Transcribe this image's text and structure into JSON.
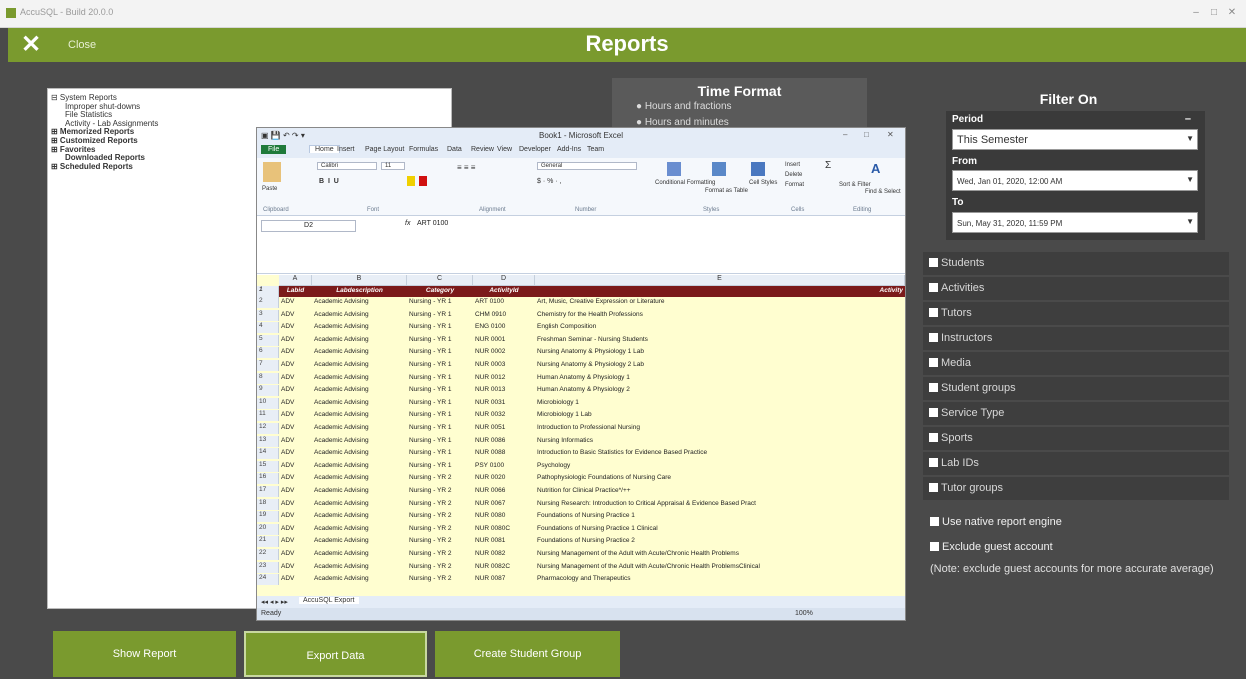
{
  "os_window": {
    "title": "AccuSQL - Build 20.0.0"
  },
  "header": {
    "close_label": "Close",
    "title": "Reports"
  },
  "tree": [
    {
      "label": "System Reports",
      "prefix": "⊟",
      "bold": false,
      "indent": 0
    },
    {
      "label": "Improper shut-downs",
      "prefix": "",
      "bold": false,
      "indent": 1
    },
    {
      "label": "File Statistics",
      "prefix": "",
      "bold": false,
      "indent": 1
    },
    {
      "label": "Activity - Lab Assignments",
      "prefix": "",
      "bold": false,
      "indent": 1
    },
    {
      "label": "Memorized Reports",
      "prefix": "⊞",
      "bold": true,
      "indent": 0
    },
    {
      "label": "Customized Reports",
      "prefix": "⊞",
      "bold": true,
      "indent": 0
    },
    {
      "label": "Favorites",
      "prefix": "⊞",
      "bold": true,
      "indent": 0
    },
    {
      "label": "Downloaded Reports",
      "prefix": "",
      "bold": true,
      "indent": 1
    },
    {
      "label": "Scheduled Reports",
      "prefix": "⊞",
      "bold": true,
      "indent": 0
    }
  ],
  "time_format": {
    "title": "Time Format",
    "options": [
      "Hours and fractions",
      "Hours and minutes"
    ]
  },
  "filter": {
    "title": "Filter On",
    "period_label": "Period",
    "period_value": "This Semester",
    "from_label": "From",
    "from_value": "Wed, Jan 01, 2020, 12:00 AM",
    "to_label": "To",
    "to_value": "Sun, May 31, 2020, 11:59 PM",
    "categories": [
      "Students",
      "Activities",
      "Tutors",
      "Instructors",
      "Media",
      "Student groups",
      "Service Type",
      "Sports",
      "Lab IDs",
      "Tutor groups"
    ],
    "option_native": "Use native report engine",
    "option_guest": "Exclude guest account",
    "note": "(Note: exclude guest accounts for more accurate average)"
  },
  "buttons": {
    "show_report": "Show Report",
    "export_data": "Export Data",
    "create_group": "Create Student Group"
  },
  "excel": {
    "window_title": "Book1 - Microsoft Excel",
    "tabs": [
      "File",
      "Home",
      "Insert",
      "Page Layout",
      "Formulas",
      "Data",
      "Review",
      "View",
      "Developer",
      "Add-Ins",
      "Team"
    ],
    "ribbon": {
      "font_name": "Calibri",
      "font_size": "11",
      "number_format": "General",
      "paste": "Paste",
      "conditional": "Conditional Formatting",
      "format_table": "Format as Table",
      "cell_styles": "Cell Styles",
      "insert": "Insert",
      "delete": "Delete",
      "format": "Format",
      "sort": "Sort & Filter",
      "find": "Find & Select",
      "groups": [
        "Clipboard",
        "Font",
        "Alignment",
        "Number",
        "Styles",
        "Cells",
        "Editing"
      ]
    },
    "name_box": "D2",
    "formula": "ART 0100",
    "columns": [
      "A",
      "B",
      "C",
      "D",
      "E"
    ],
    "header_row": [
      "Labid",
      "Labdescription",
      "Category",
      "ActivityId",
      "Activity"
    ],
    "rows": [
      [
        "ADV",
        "Academic Advising",
        "Nursing - YR 1",
        "ART 0100",
        "Art, Music, Creative Expression or Literature"
      ],
      [
        "ADV",
        "Academic Advising",
        "Nursing - YR 1",
        "CHM 0910",
        "Chemistry for the Health Professions"
      ],
      [
        "ADV",
        "Academic Advising",
        "Nursing - YR 1",
        "ENG 0100",
        "English Composition"
      ],
      [
        "ADV",
        "Academic Advising",
        "Nursing - YR 1",
        "NUR 0001",
        "Freshman Seminar - Nursing Students"
      ],
      [
        "ADV",
        "Academic Advising",
        "Nursing - YR 1",
        "NUR 0002",
        "Nursing Anatomy & Physiology 1 Lab"
      ],
      [
        "ADV",
        "Academic Advising",
        "Nursing - YR 1",
        "NUR 0003",
        "Nursing Anatomy & Physiology 2 Lab"
      ],
      [
        "ADV",
        "Academic Advising",
        "Nursing - YR 1",
        "NUR 0012",
        "Human Anatomy & Physiology 1"
      ],
      [
        "ADV",
        "Academic Advising",
        "Nursing - YR 1",
        "NUR 0013",
        "Human Anatomy & Physiology 2"
      ],
      [
        "ADV",
        "Academic Advising",
        "Nursing - YR 1",
        "NUR 0031",
        "Microbiology 1"
      ],
      [
        "ADV",
        "Academic Advising",
        "Nursing - YR 1",
        "NUR 0032",
        "Microbiology 1 Lab"
      ],
      [
        "ADV",
        "Academic Advising",
        "Nursing - YR 1",
        "NUR 0051",
        "Introduction to Professional Nursing"
      ],
      [
        "ADV",
        "Academic Advising",
        "Nursing - YR 1",
        "NUR 0086",
        "Nursing Informatics"
      ],
      [
        "ADV",
        "Academic Advising",
        "Nursing - YR 1",
        "NUR 0088",
        "Introduction to Basic Statistics for Evidence Based Practice"
      ],
      [
        "ADV",
        "Academic Advising",
        "Nursing - YR 1",
        "PSY 0100",
        "Psychology"
      ],
      [
        "ADV",
        "Academic Advising",
        "Nursing - YR 2",
        "NUR 0020",
        "Pathophysiologic Foundations of Nursing Care"
      ],
      [
        "ADV",
        "Academic Advising",
        "Nursing - YR 2",
        "NUR 0066",
        "Nutrition for Clinical Practice*/++"
      ],
      [
        "ADV",
        "Academic Advising",
        "Nursing - YR 2",
        "NUR 0067",
        "Nursing Research: Introduction to Critical Appraisal & Evidence Based Pract"
      ],
      [
        "ADV",
        "Academic Advising",
        "Nursing - YR 2",
        "NUR 0080",
        "Foundations of Nursing Practice 1"
      ],
      [
        "ADV",
        "Academic Advising",
        "Nursing - YR 2",
        "NUR 0080C",
        "Foundations of Nursing Practice 1 Clinical"
      ],
      [
        "ADV",
        "Academic Advising",
        "Nursing - YR 2",
        "NUR 0081",
        "Foundations of Nursing Practice 2"
      ],
      [
        "ADV",
        "Academic Advising",
        "Nursing - YR 2",
        "NUR 0082",
        "Nursing Management of the Adult with Acute/Chronic Health Problems"
      ],
      [
        "ADV",
        "Academic Advising",
        "Nursing - YR 2",
        "NUR 0082C",
        "Nursing Management of the Adult with Acute/Chronic Health ProblemsClinical"
      ],
      [
        "ADV",
        "Academic Advising",
        "Nursing - YR 2",
        "NUR 0087",
        "Pharmacology and Therapeutics"
      ]
    ],
    "sheet_tab": "AccuSQL Export",
    "status_ready": "Ready",
    "zoom": "100%"
  },
  "colors": {
    "accent": "#7a9a2e",
    "panel": "#3e3e3e",
    "header_row": "#7b1a1a",
    "cells": "#fffed0"
  }
}
